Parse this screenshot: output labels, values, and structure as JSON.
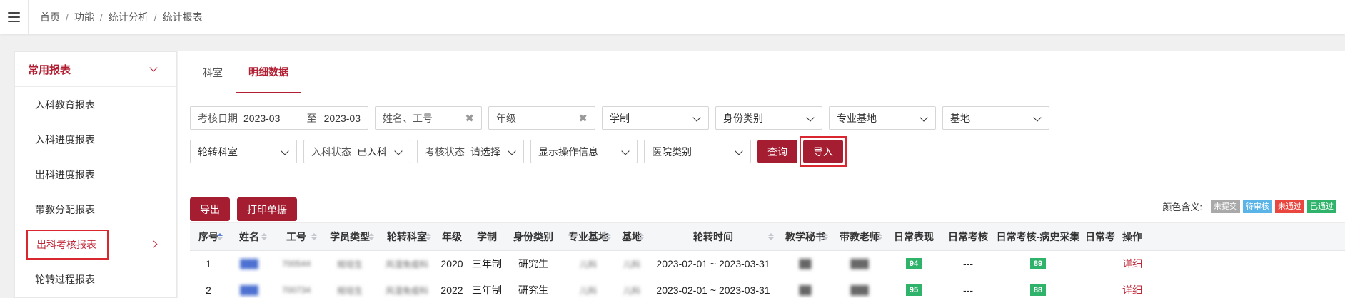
{
  "breadcrumb": [
    "首页",
    "功能",
    "统计分析",
    "统计报表"
  ],
  "sidebar": {
    "header": "常用报表",
    "items": [
      {
        "label": "入科教育报表"
      },
      {
        "label": "入科进度报表"
      },
      {
        "label": "出科进度报表"
      },
      {
        "label": "带教分配报表"
      },
      {
        "label": "出科考核报表"
      },
      {
        "label": "轮转过程报表"
      }
    ]
  },
  "tabs": [
    {
      "label": "科室"
    },
    {
      "label": "明细数据"
    }
  ],
  "filters": {
    "date_label": "考核日期",
    "date_from": "2023-03",
    "date_sep": "至",
    "date_to": "2023-03",
    "name_placeholder": "姓名、工号",
    "grade_placeholder": "年级",
    "system": "学制",
    "identity": "身份类别",
    "major_base": "专业基地",
    "base": "基地",
    "rotation_dept": "轮转科室",
    "entry_status_label": "入科状态",
    "entry_status_value": "已入科",
    "exam_status_label": "考核状态",
    "exam_status_value": "请选择",
    "show_ops": "显示操作信息",
    "hospital_type": "医院类别",
    "query_button": "查询",
    "import_button": "导入"
  },
  "actions": {
    "export_button": "导出",
    "print_button": "打印单据"
  },
  "legend": {
    "title": "颜色含义:",
    "items": [
      {
        "label": "未提交",
        "color": "#a9a9a9"
      },
      {
        "label": "待审核",
        "color": "#5bb4e8"
      },
      {
        "label": "未通过",
        "color": "#e9463f"
      },
      {
        "label": "已通过",
        "color": "#2fb36b"
      }
    ]
  },
  "table": {
    "columns": [
      "序号",
      "姓名",
      "工号",
      "学员类型",
      "轮转科室",
      "年级",
      "学制",
      "身份类别",
      "专业基地",
      "基地",
      "轮转时间",
      "教学秘书",
      "带教老师",
      "日常表现",
      "日常考核",
      "日常考核-病史采集",
      "日常考",
      "操作"
    ],
    "rows": [
      {
        "index": "1",
        "name": "███",
        "id": "700544",
        "type": "规培生",
        "dept": "风湿免疫科",
        "grade": "2020",
        "system": "三年制",
        "identity": "研究生",
        "major_base": "儿科",
        "base": "儿科",
        "period": "2023-02-01 ~ 2023-03-31",
        "secretary": "██",
        "teacher": "███",
        "daily": "94",
        "daily_exam": "---",
        "history": "89",
        "op": "详细"
      },
      {
        "index": "2",
        "name": "███",
        "id": "700734",
        "type": "规培生",
        "dept": "风湿免疫科",
        "grade": "2022",
        "system": "三年制",
        "identity": "研究生",
        "major_base": "儿科",
        "base": "儿科",
        "period": "2023-02-01 ~ 2023-03-31",
        "secretary": "██",
        "teacher": "███",
        "daily": "95",
        "daily_exam": "---",
        "history": "88",
        "op": "详细"
      }
    ]
  }
}
